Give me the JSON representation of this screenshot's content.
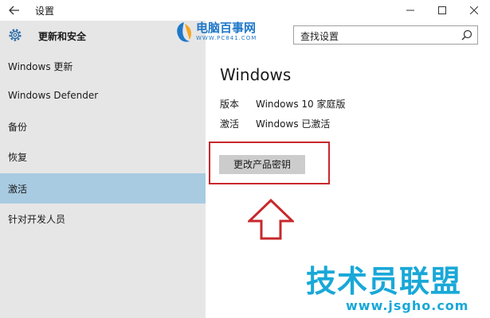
{
  "window": {
    "title": "设置"
  },
  "sidebar": {
    "header_label": "更新和安全",
    "items": [
      {
        "label": "Windows 更新"
      },
      {
        "label": "Windows Defender"
      },
      {
        "label": "备份"
      },
      {
        "label": "恢复"
      },
      {
        "label": "激活",
        "selected": true
      },
      {
        "label": "针对开发人员"
      }
    ]
  },
  "search": {
    "placeholder": "查找设置"
  },
  "main": {
    "title": "Windows",
    "rows": [
      {
        "key": "版本",
        "value": "Windows 10 家庭版"
      },
      {
        "key": "激活",
        "value": "Windows 已激活"
      }
    ],
    "change_key_button": "更改产品密钥"
  },
  "overlays": {
    "logo_text": "电脑百事网",
    "logo_url": "WWW.PC841.COM",
    "watermark_title": "技术员联盟",
    "watermark_url": "www.jsgho.com",
    "highlight_color": "#c8282c",
    "watermark_color": "#19a8d8"
  },
  "colors": {
    "sidebar_bg": "#e6e6e6",
    "selected_bg": "#a8cbe2",
    "button_bg": "#cccccc"
  }
}
